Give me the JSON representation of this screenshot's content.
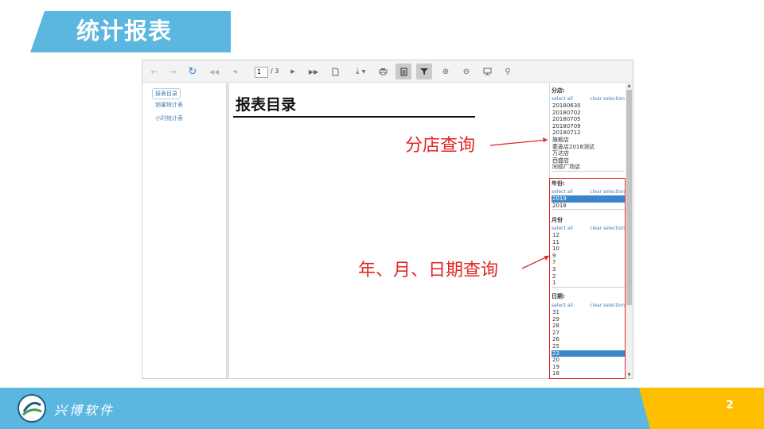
{
  "slide": {
    "title": "统计报表",
    "page_number": "2",
    "company": "兴博软件"
  },
  "toolbar": {
    "page_current": "1",
    "page_total": "/ 3",
    "icons": [
      "undo-icon",
      "redo-icon",
      "refresh-icon",
      "first-page-icon",
      "prev-page-icon",
      "next-page-icon",
      "last-page-icon",
      "new-page-icon",
      "download-icon",
      "print-icon",
      "toc-icon",
      "filter-icon",
      "zoom-in-icon",
      "zoom-out-icon",
      "fullscreen-icon",
      "search-icon"
    ]
  },
  "toc": {
    "items": [
      "报表目录",
      "销量统计表",
      "小时统计表"
    ]
  },
  "content": {
    "title": "报表目录"
  },
  "filters": {
    "select_all": "select all",
    "clear_selection": "clear selection",
    "branch": {
      "label": "分店:",
      "items": [
        "20180630",
        "20180702",
        "20180705",
        "20180709",
        "20180712",
        "旗舰店",
        "萎菱店2018测试",
        "万达店",
        "西盛店",
        "同德广场店"
      ]
    },
    "year": {
      "label": "年份:",
      "items": [
        "2019",
        "2018"
      ],
      "selected": "2019"
    },
    "month": {
      "label": "月份",
      "items": [
        "12",
        "11",
        "10",
        "9",
        "7",
        "3",
        "2",
        "1"
      ]
    },
    "day": {
      "label": "日期:",
      "items": [
        "31",
        "29",
        "28",
        "27",
        "26",
        "25",
        "23",
        "20",
        "19",
        "18"
      ],
      "selected": "23"
    }
  },
  "annotations": {
    "branch_query": "分店查询",
    "date_query": "年、月、日期查询"
  },
  "colors": {
    "accent_blue": "#5bb7e0",
    "accent_yellow": "#fdbf00",
    "annotation_red": "#e32626",
    "selection_blue": "#3c85c9"
  }
}
